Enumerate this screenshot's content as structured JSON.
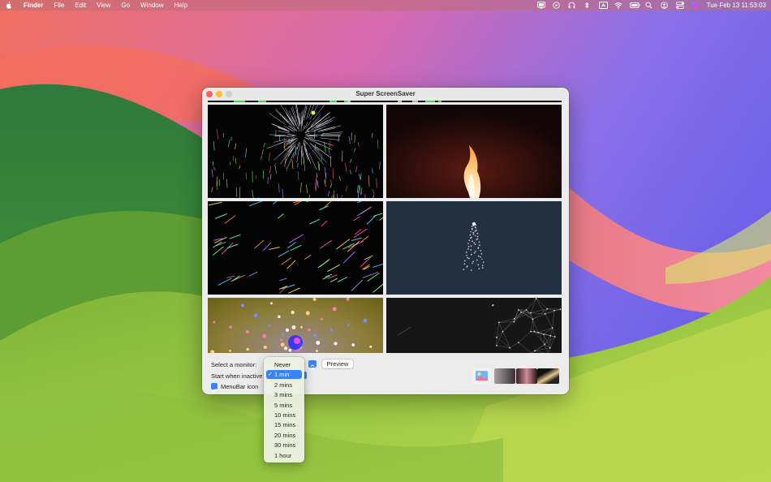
{
  "menubar": {
    "app_name": "Finder",
    "menus": [
      "File",
      "Edit",
      "View",
      "Go",
      "Window",
      "Help"
    ],
    "clock": "Tue Feb 13  11:53:03"
  },
  "window": {
    "title": "Super ScreenSaver"
  },
  "controls": {
    "monitor_label": "Select a monitor:",
    "inactive_label": "Start when inactive",
    "preview_label": "Preview",
    "menubar_icon_label": "MenuBar icon",
    "menubar_icon_checked": true
  },
  "dropdown": {
    "options": [
      "Never",
      "1 min",
      "2 mins",
      "3 mins",
      "5 mins",
      "10 mins",
      "15 mins",
      "20 mins",
      "30 mins",
      "1 hour"
    ],
    "selected": "1 min"
  },
  "screensavers": [
    {
      "name": "fireworks"
    },
    {
      "name": "candle-flame"
    },
    {
      "name": "meteor-shower"
    },
    {
      "name": "particle-tree"
    },
    {
      "name": "light-spiral"
    },
    {
      "name": "constellation-network"
    }
  ],
  "colors": {
    "accent": "#3b82f6",
    "progress": "#4bd44b"
  }
}
